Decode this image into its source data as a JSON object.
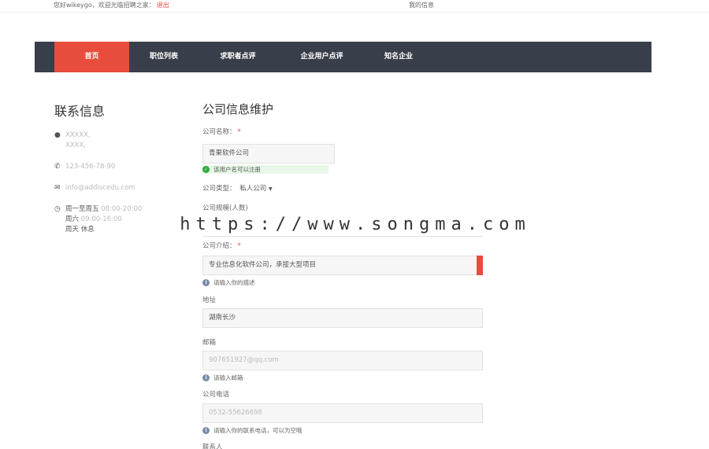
{
  "topbar": {
    "greeting": "您好wikeygo，欢迎光临招聘之家：",
    "logout": "退出",
    "my_info": "我的信息"
  },
  "nav": {
    "items": [
      "首页",
      "职位列表",
      "求职者点评",
      "企业用户点评",
      "知名企业"
    ],
    "active_index": 0
  },
  "contact": {
    "title": "联系信息",
    "address_line1": "XXXXX,",
    "address_line2": "XXXX,",
    "phone": "123-456-78-90",
    "email": "info@addiscedu.com",
    "hours_weekday": "周一至周五",
    "hours_weekday_time": "08:00-20:00",
    "hours_saturday": "周六",
    "hours_saturday_time": "09:00-16:00",
    "hours_sunday": "周天 休息"
  },
  "form": {
    "title": "公司信息维护",
    "company_name_label": "公司名称：",
    "company_name_value": "青果软件公司",
    "company_name_ok": "该用户名可以注册",
    "company_type_label": "公司类型：",
    "company_type_value": "私人公司",
    "company_size_label": "公司规模(人数)",
    "company_intro_label": "公司介绍：",
    "company_intro_value": "专业信息化软件公司，承接大型项目",
    "company_intro_hint": "请输入你的描述",
    "address_label": "地址",
    "address_value": "湖南长沙",
    "email_label": "邮箱",
    "email_placeholder": "907651927@qq.com",
    "email_hint": "请输入邮箱",
    "phone_label": "公司电话",
    "phone_placeholder": "0532-55626698",
    "phone_hint": "请输入你的联系电话，可以为空哦",
    "contact_person_label": "联系人"
  },
  "watermark": "https://www.songma.com",
  "colors": {
    "accent": "#e74c3c",
    "navbar": "#393f4a",
    "ok": "#2eaa3c",
    "info": "#7a8ba7"
  }
}
